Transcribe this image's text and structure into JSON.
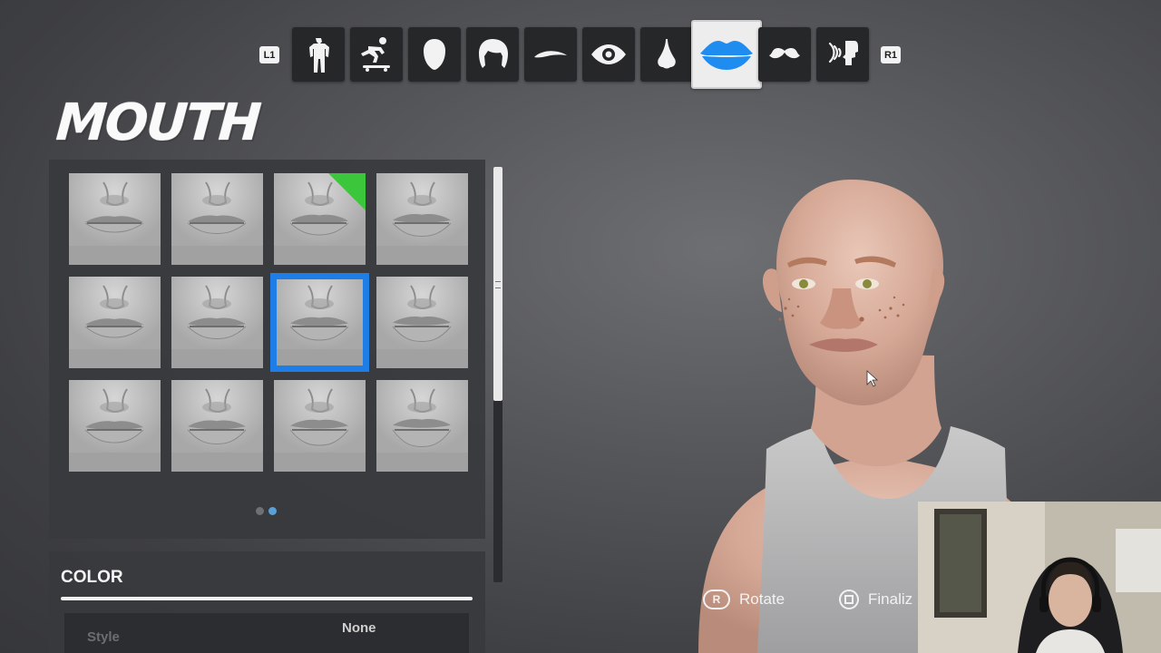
{
  "topbar": {
    "left_bumper": "L1",
    "right_bumper": "R1",
    "tabs": [
      {
        "icon": "body-icon"
      },
      {
        "icon": "skateboarder-icon"
      },
      {
        "icon": "head-icon"
      },
      {
        "icon": "hair-icon"
      },
      {
        "icon": "eyebrow-icon"
      },
      {
        "icon": "eye-icon"
      },
      {
        "icon": "nose-icon"
      },
      {
        "icon": "lips-icon",
        "active": true
      },
      {
        "icon": "mustache-icon"
      },
      {
        "icon": "voice-icon"
      }
    ],
    "active_color": "#1f8cf0"
  },
  "title": "MOUTH",
  "grid": {
    "items": 12,
    "equipped_index": 2,
    "selected_index": 6,
    "selection_color": "#1f7ee6",
    "equipped_color": "#3cc63c",
    "page": 2,
    "page_count": 2
  },
  "color_panel": {
    "label": "COLOR",
    "style_label": "Style",
    "style_value": "None"
  },
  "prompts": {
    "rotate_button": "R",
    "rotate_label": "Rotate",
    "finalize_label": "Finaliz"
  }
}
